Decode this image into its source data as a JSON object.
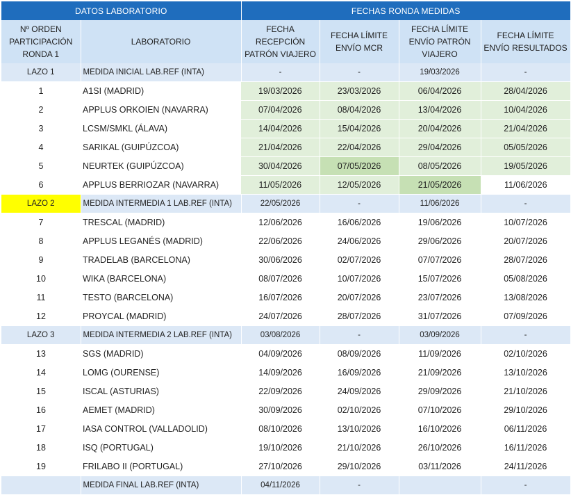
{
  "header": {
    "group_left": "DATOS LABORATORIO",
    "group_right": "FECHAS RONDA MEDIDAS",
    "col_order": "Nº ORDEN PARTICIPACIÓN RONDA 1",
    "col_lab": "LABORATORIO",
    "col_recepcion": "FECHA RECEPCIÓN PATRÓN VIAJERO",
    "col_mcr": "FECHA LÍMITE ENVÍO MCR",
    "col_envio_patron": "FECHA LÍMITE ENVÍO PATRÓN VIAJERO",
    "col_resultados": "FECHA LÍMITE ENVÍO RESULTADOS"
  },
  "colors": {
    "header_blue": "#1f6dbd",
    "subheader_blue": "#cfe2f5",
    "lazo_blue": "#dce8f6",
    "light_green": "#e1efda",
    "dark_green": "#c6e0b4",
    "highlight_yellow": "#ffff00"
  },
  "rows": [
    {
      "type": "lazo",
      "order": "LAZO 1",
      "lab": "MEDIDA INICIAL LAB.REF (INTA)",
      "recepcion": "-",
      "mcr": "-",
      "envio": "19/03/2026",
      "resultados": "-"
    },
    {
      "type": "lab",
      "order": "1",
      "lab": "A1SI (MADRID)",
      "recepcion": "19/03/2026",
      "mcr": "23/03/2026",
      "envio": "06/04/2026",
      "resultados": "28/04/2026"
    },
    {
      "type": "lab",
      "order": "2",
      "lab": "APPLUS ORKOIEN (NAVARRA)",
      "recepcion": "07/04/2026",
      "mcr": "08/04/2026",
      "envio": "13/04/2026",
      "resultados": "10/04/2026"
    },
    {
      "type": "lab",
      "order": "3",
      "lab": "LCSM/SMKL (ÁLAVA)",
      "recepcion": "14/04/2026",
      "mcr": "15/04/2026",
      "envio": "20/04/2026",
      "resultados": "21/04/2026"
    },
    {
      "type": "lab",
      "order": "4",
      "lab": "SARIKAL (GUIPÚZCOA)",
      "recepcion": "21/04/2026",
      "mcr": "22/04/2026",
      "envio": "29/04/2026",
      "resultados": "05/05/2026"
    },
    {
      "type": "lab",
      "order": "5",
      "lab": "NEURTEK (GUIPÚZCOA)",
      "recepcion": "30/04/2026",
      "mcr": "07/05/2026",
      "envio": "08/05/2026",
      "resultados": "19/05/2026"
    },
    {
      "type": "lab",
      "order": "6",
      "lab": "APPLUS BERRIOZAR (NAVARRA)",
      "recepcion": "11/05/2026",
      "mcr": "12/05/2026",
      "envio": "21/05/2026",
      "resultados": "11/06/2026"
    },
    {
      "type": "lazo",
      "order": "LAZO 2",
      "lab": "MEDIDA INTERMEDIA 1 LAB.REF (INTA)",
      "recepcion": "22/05/2026",
      "mcr": "-",
      "envio": "11/06/2026",
      "resultados": "-"
    },
    {
      "type": "lab",
      "order": "7",
      "lab": "TRESCAL (MADRID)",
      "recepcion": "12/06/2026",
      "mcr": "16/06/2026",
      "envio": "19/06/2026",
      "resultados": "10/07/2026"
    },
    {
      "type": "lab",
      "order": "8",
      "lab": "APPLUS LEGANÉS (MADRID)",
      "recepcion": "22/06/2026",
      "mcr": "24/06/2026",
      "envio": "29/06/2026",
      "resultados": "20/07/2026"
    },
    {
      "type": "lab",
      "order": "9",
      "lab": "TRADELAB (BARCELONA)",
      "recepcion": "30/06/2026",
      "mcr": "02/07/2026",
      "envio": "07/07/2026",
      "resultados": "28/07/2026"
    },
    {
      "type": "lab",
      "order": "10",
      "lab": "WIKA (BARCELONA)",
      "recepcion": "08/07/2026",
      "mcr": "10/07/2026",
      "envio": "15/07/2026",
      "resultados": "05/08/2026"
    },
    {
      "type": "lab",
      "order": "11",
      "lab": "TESTO (BARCELONA)",
      "recepcion": "16/07/2026",
      "mcr": "20/07/2026",
      "envio": "23/07/2026",
      "resultados": "13/08/2026"
    },
    {
      "type": "lab",
      "order": "12",
      "lab": "PROYCAL (MADRID)",
      "recepcion": "24/07/2026",
      "mcr": "28/07/2026",
      "envio": "31/07/2026",
      "resultados": "07/09/2026"
    },
    {
      "type": "lazo",
      "order": "LAZO 3",
      "lab": "MEDIDA INTERMEDIA 2 LAB.REF (INTA)",
      "recepcion": "03/08/2026",
      "mcr": "-",
      "envio": "03/09/2026",
      "resultados": "-"
    },
    {
      "type": "lab",
      "order": "13",
      "lab": "SGS (MADRID)",
      "recepcion": "04/09/2026",
      "mcr": "08/09/2026",
      "envio": "11/09/2026",
      "resultados": "02/10/2026"
    },
    {
      "type": "lab",
      "order": "14",
      "lab": "LOMG (OURENSE)",
      "recepcion": "14/09/2026",
      "mcr": "16/09/2026",
      "envio": "21/09/2026",
      "resultados": "13/10/2026"
    },
    {
      "type": "lab",
      "order": "15",
      "lab": "ISCAL (ASTURIAS)",
      "recepcion": "22/09/2026",
      "mcr": "24/09/2026",
      "envio": "29/09/2026",
      "resultados": "21/10/2026"
    },
    {
      "type": "lab",
      "order": "16",
      "lab": "AEMET (MADRID)",
      "recepcion": "30/09/2026",
      "mcr": "02/10/2026",
      "envio": "07/10/2026",
      "resultados": "29/10/2026"
    },
    {
      "type": "lab",
      "order": "17",
      "lab": "IASA CONTROL (VALLADOLID)",
      "recepcion": "08/10/2026",
      "mcr": "13/10/2026",
      "envio": "16/10/2026",
      "resultados": "06/11/2026"
    },
    {
      "type": "lab",
      "order": "18",
      "lab": "ISQ (PORTUGAL)",
      "recepcion": "19/10/2026",
      "mcr": "21/10/2026",
      "envio": "26/10/2026",
      "resultados": "16/11/2026"
    },
    {
      "type": "lab",
      "order": "19",
      "lab": "FRILABO II (PORTUGAL)",
      "recepcion": "27/10/2026",
      "mcr": "29/10/2026",
      "envio": "03/11/2026",
      "resultados": "24/11/2026"
    },
    {
      "type": "lazo",
      "order": "",
      "lab": "MEDIDA FINAL LAB.REF (INTA)",
      "recepcion": "04/11/2026",
      "mcr": "-",
      "envio": "",
      "resultados": "-"
    }
  ]
}
